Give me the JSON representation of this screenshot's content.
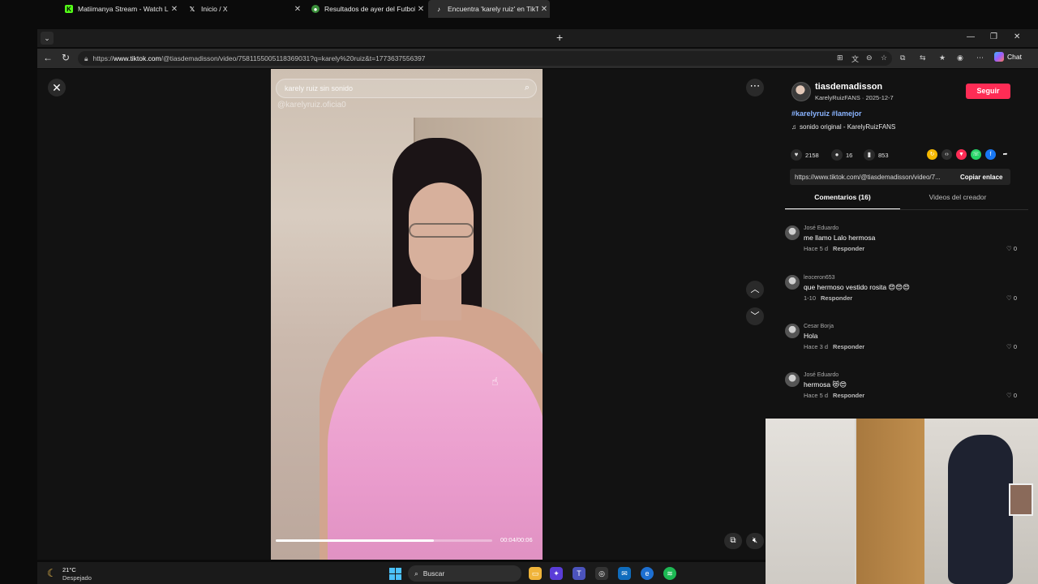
{
  "browser": {
    "tabs": [
      {
        "label": "Matiimanya Stream - Watch Live o",
        "icon": "kick-icon",
        "active": false
      },
      {
        "label": "Inicio / X",
        "icon": "x-icon",
        "active": false
      },
      {
        "label": "Resultados de ayer del Futbol Arg",
        "icon": "football-icon",
        "active": false
      },
      {
        "label": "Encuentra 'karely ruiz' en TikTok |",
        "icon": "tiktok-icon",
        "active": true
      }
    ],
    "url_prefix": "https://",
    "url_host": "www.tiktok.com",
    "url_rest": "/@tiasdemadisson/video/7581155005118369031?q=karely%20ruiz&t=1773637556397",
    "chat_label": "Chat"
  },
  "video": {
    "search_text": "karely ruiz sin sonido",
    "watermark": "@karelyruiz.oficia0",
    "progress": 0.73,
    "time": "00:04/00:06"
  },
  "creator": {
    "name": "tiasdemadisson",
    "subtitle": "KarelyRuizFANS · 2025-12-7",
    "follow_label": "Seguir",
    "hashtags": "#karelyruiz #lamejor",
    "sound": "sonido original - KarelyRuizFANS"
  },
  "stats": {
    "likes": "2158",
    "comments": "16",
    "saves": "853"
  },
  "link": {
    "url": "https://www.tiktok.com/@tiasdemadisson/video/7...",
    "copy_label": "Copiar enlace"
  },
  "comment_tabs": {
    "comments": "Comentarios (16)",
    "videos": "Videos del creador"
  },
  "comments": [
    {
      "user": "José Eduardo",
      "text": "me llamo Lalo hermosa",
      "time": "Hace 5 d",
      "reply": "Responder",
      "likes": "0"
    },
    {
      "user": "leoceron653",
      "text": "que hermoso vestido rosita 😍😍😍",
      "time": "1-10",
      "reply": "Responder",
      "likes": "0"
    },
    {
      "user": "Cesar Borja",
      "text": "Hola",
      "time": "Hace 3 d",
      "reply": "Responder",
      "likes": "0"
    },
    {
      "user": "José Eduardo",
      "text": "hermosa 😻😍",
      "time": "Hace 5 d",
      "reply": "Responder",
      "likes": "0"
    }
  ],
  "taskbar": {
    "temp": "21°C",
    "weather": "Despejado",
    "search_label": "Buscar"
  }
}
